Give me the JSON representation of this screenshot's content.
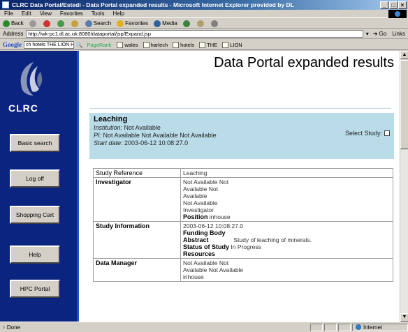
{
  "window": {
    "title": "CLRC Data Portal/Estedi - Data Portal expanded results - Microsoft Internet Explorer provided by DL",
    "min": "_",
    "max": "□",
    "close": "×"
  },
  "menu": [
    "File",
    "Edit",
    "View",
    "Favorites",
    "Tools",
    "Help"
  ],
  "toolbar": {
    "back": "Back",
    "search": "Search",
    "favorites": "Favorites",
    "media": "Media"
  },
  "address": {
    "label": "Address",
    "url": "http://wk-pc1.dl.ac.uk:8080/dataportal/jsp/Expand.jsp",
    "go": "Go",
    "links": "Links"
  },
  "google": {
    "logo": "Google",
    "query": "ch hotels THE LION HOTEL",
    "pagerank": "PageRank",
    "bookmarks": [
      "wales",
      "harlech",
      "hotels",
      "THE",
      "LION"
    ]
  },
  "sidebar": {
    "logo_text": "CLRC",
    "buttons": [
      "Basic search",
      "Log off",
      "Shopping Cart",
      "Help",
      "HPC Portal"
    ]
  },
  "page": {
    "title": "Data Portal expanded results"
  },
  "study": {
    "name": "Leaching",
    "institution_label": "Institution:",
    "institution_value": "Not Available",
    "pi_label": "PI:",
    "pi_value": "Not Available Not Available Not Available",
    "start_label": "Start date:",
    "start_value": "2003-06-12 10:08:27.0",
    "select_label": "Select Study:"
  },
  "details": {
    "study_reference_label": "Study Reference",
    "study_reference_value": "Leaching",
    "investigator_label": "Investigator",
    "investigator_lines": [
      "Not Available Not",
      "Available Not",
      "Available",
      "Not Available",
      "Investigator"
    ],
    "position_label": "Position",
    "position_value": "inhouse",
    "study_info_label": "Study Information",
    "study_info_date": "2003-06-12 10:08:27.0",
    "funding_body_label": "Funding Body",
    "abstract_label": "Abstract",
    "abstract_value": "Study of leaching of minerals.",
    "status_label": "Status of Study",
    "status_value": "In Progress",
    "resources_label": "Resources",
    "data_manager_label": "Data Manager",
    "data_manager_lines": [
      "Not Available Not",
      "Available Not Available",
      "inhouse"
    ]
  },
  "status": {
    "text": "Done",
    "zone": "Internet"
  }
}
